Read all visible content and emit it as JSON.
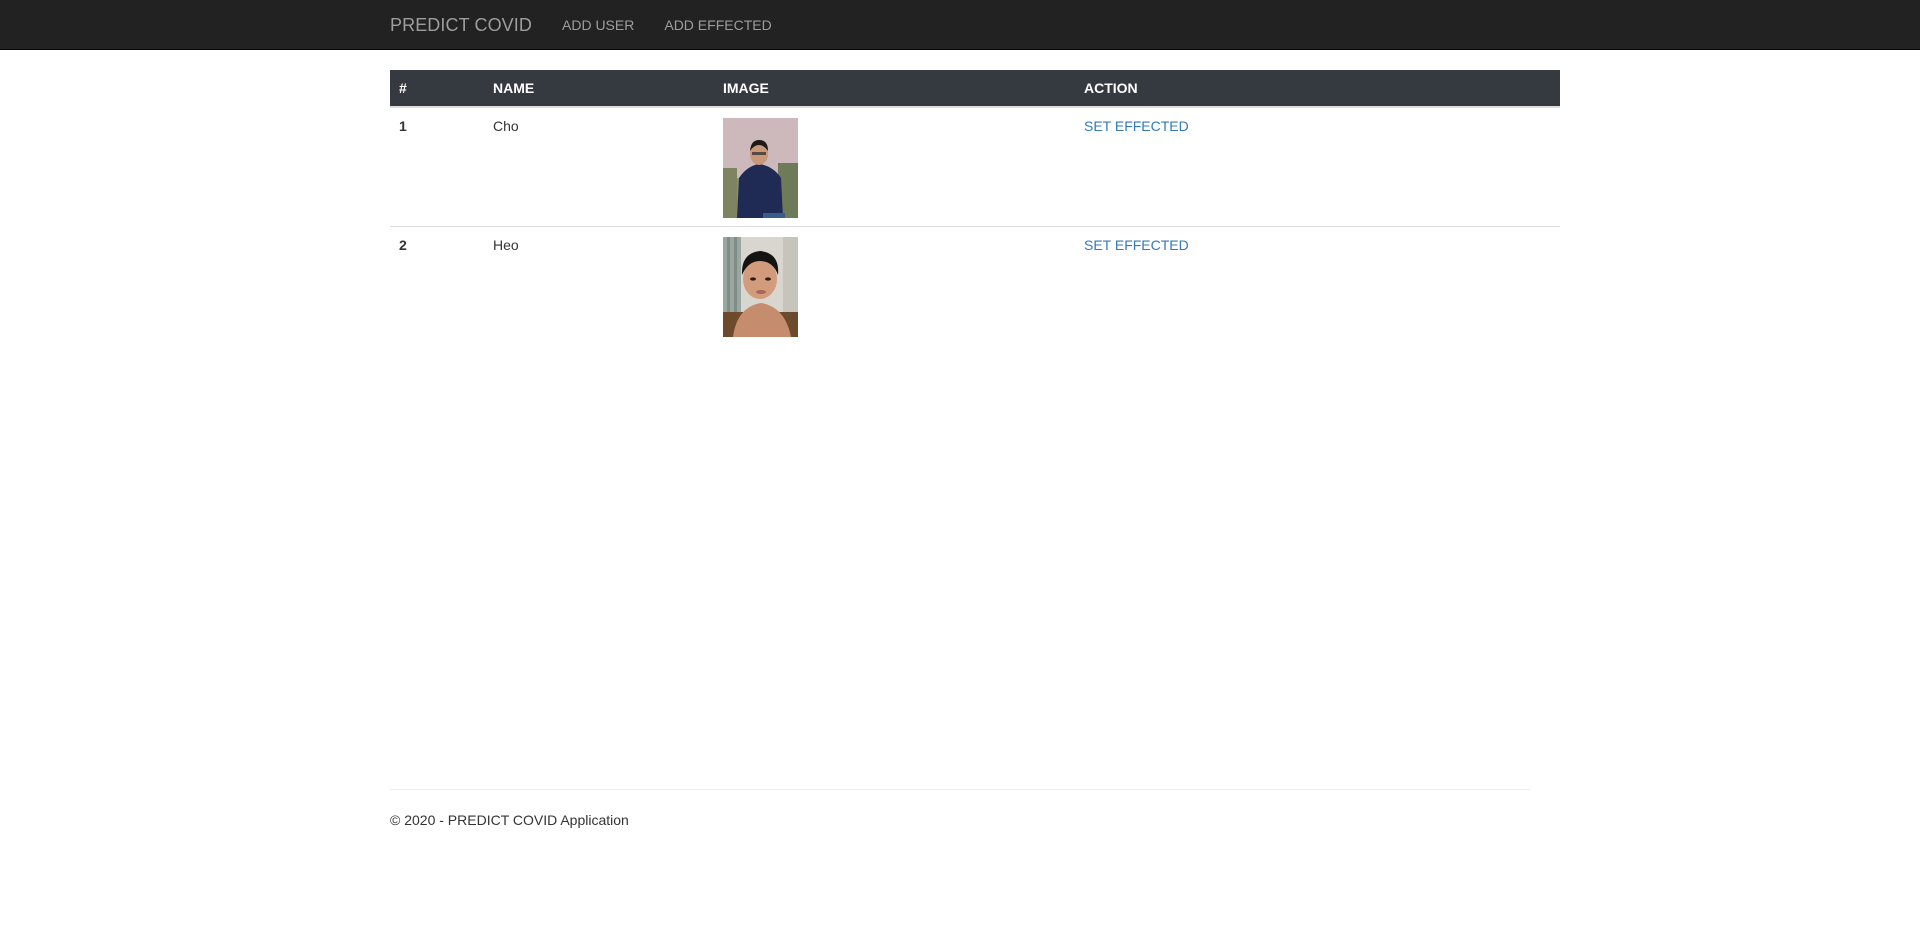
{
  "navbar": {
    "brand": "PREDICT COVID",
    "links": [
      {
        "label": "ADD USER"
      },
      {
        "label": "ADD EFFECTED"
      }
    ]
  },
  "table": {
    "headers": [
      "#",
      "NAME",
      "IMAGE",
      "ACTION"
    ],
    "rows": [
      {
        "num": "1",
        "name": "Cho",
        "image": "person-photo",
        "action": "SET EFFECTED"
      },
      {
        "num": "2",
        "name": "Heo",
        "image": "person-photo",
        "action": "SET EFFECTED"
      }
    ]
  },
  "footer": {
    "text": "© 2020 - PREDICT COVID Application"
  },
  "colors": {
    "navbar_bg": "#222222",
    "nav_text": "#9d9d9d",
    "table_header_bg": "#343a40",
    "link": "#337ab7"
  }
}
